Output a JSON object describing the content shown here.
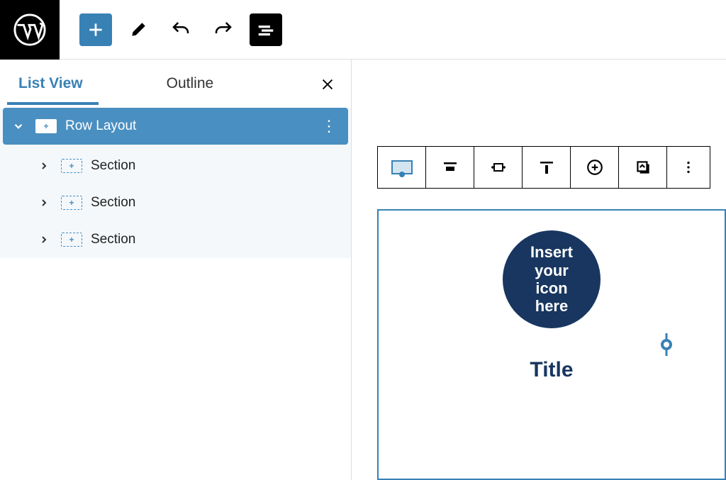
{
  "topbar": {
    "wp_logo": "WordPress"
  },
  "sidebar": {
    "tabs": {
      "list_view": "List View",
      "outline": "Outline"
    },
    "tree": {
      "root": "Row Layout",
      "children": [
        "Section",
        "Section",
        "Section"
      ]
    }
  },
  "canvas": {
    "icon_placeholder": {
      "l1": "Insert",
      "l2": "your",
      "l3": "icon",
      "l4": "here"
    },
    "title_placeholder": "Title"
  }
}
